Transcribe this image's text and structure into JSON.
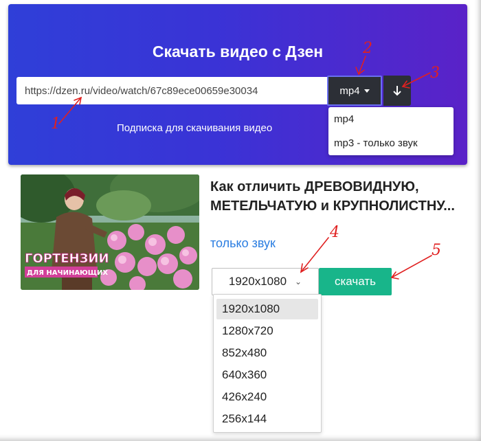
{
  "header": {
    "title": "Скачать видео с Дзен",
    "url_value": "https://dzen.ru/video/watch/67c89ece00659e30034",
    "format_selected": "mp4",
    "format_options": [
      "mp4",
      "mp3 - только звук"
    ],
    "subscribe_label": "Подписка для скачивания видео"
  },
  "video": {
    "title": "Как отличить ДРЕВОВИДНУЮ, МЕТЕЛЬЧАТУЮ и КРУПНОЛИСТНУ...",
    "thumb_caption_line1": "ГОРТЕНЗИИ",
    "thumb_caption_line2": "ДЛЯ НАЧИНАЮЩИХ",
    "audio_only_label": "только звук",
    "resolution_selected": "1920x1080",
    "download_label": "скачать",
    "resolution_options": [
      "1920x1080",
      "1280x720",
      "852x480",
      "640x360",
      "426x240",
      "256x144"
    ]
  },
  "annotations": {
    "n1": "1",
    "n2": "2",
    "n3": "3",
    "n4": "4",
    "n5": "5",
    "color": "#e02020"
  },
  "colors": {
    "panel_start": "#2f3fd8",
    "panel_end": "#5a22c8",
    "download_green": "#18b58a",
    "link_blue": "#2a7de1"
  }
}
